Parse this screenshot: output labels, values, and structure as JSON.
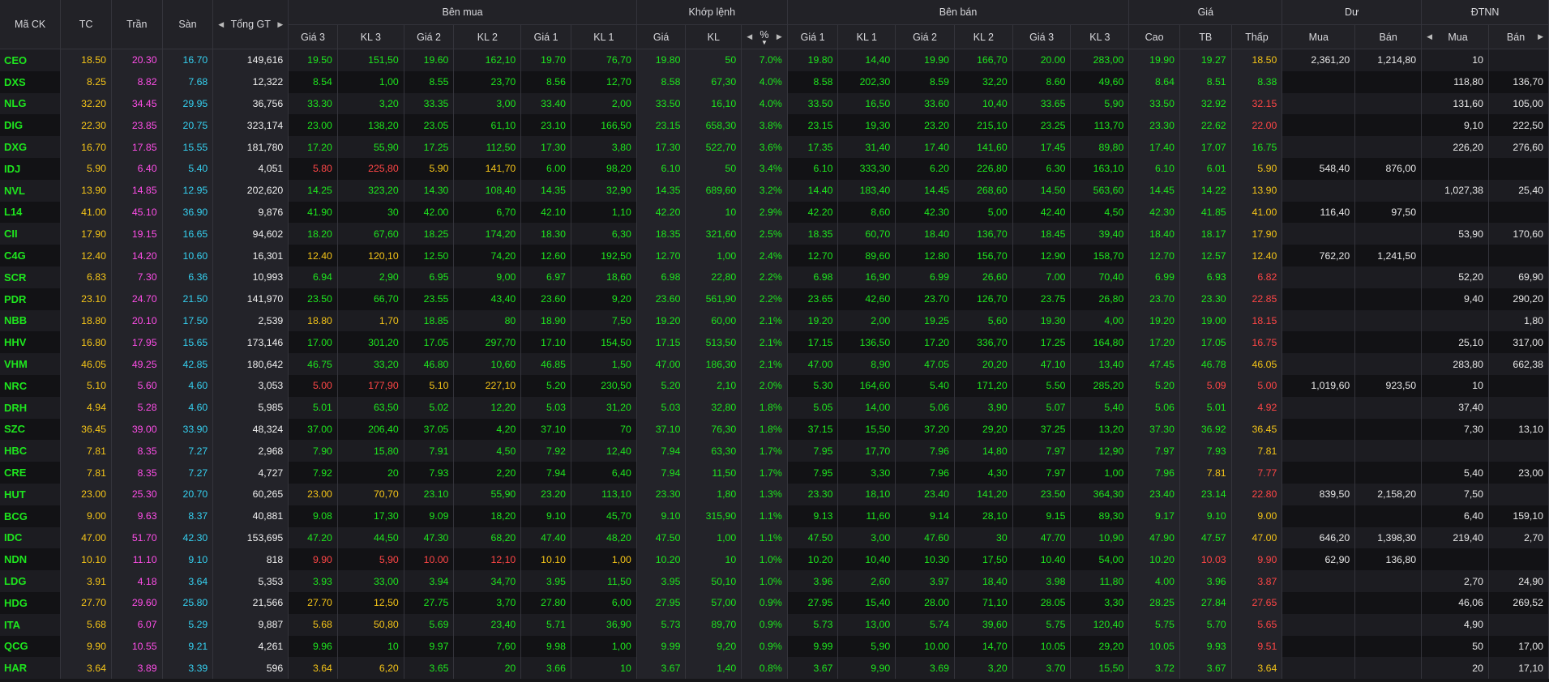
{
  "headers": {
    "symbol": "Mã CK",
    "ref": "TC",
    "ceil": "Trần",
    "floor": "Sàn",
    "total": "Tổng GT",
    "buy_group": "Bên mua",
    "match_group": "Khớp lệnh",
    "sell_group": "Bên bán",
    "price_group": "Giá",
    "surplus_group": "Dư",
    "foreign_group": "ĐTNN",
    "buy_cols": [
      "Giá 3",
      "KL 3",
      "Giá 2",
      "KL 2",
      "Giá 1",
      "KL 1"
    ],
    "match_cols": [
      "Giá",
      "KL",
      "%"
    ],
    "sell_cols": [
      "Giá 1",
      "KL 1",
      "Giá 2",
      "KL 2",
      "Giá 3",
      "KL 3"
    ],
    "price_cols": [
      "Cao",
      "TB",
      "Thấp"
    ],
    "surplus_cols": [
      "Mua",
      "Bán"
    ],
    "foreign_cols": [
      "Mua",
      "Bán"
    ]
  },
  "colors": {
    "up": "#1ee61e",
    "down": "#ff4646",
    "ref": "#f5c518",
    "ceil": "#ff4ee8",
    "floor": "#35d0f0"
  },
  "rows": [
    {
      "s": "CEO",
      "tc": "18.50",
      "tran": "20.30",
      "san": "16.70",
      "gt": "149,616",
      "b3": "19.50",
      "bk3": "151,50",
      "b2": "19.60",
      "bk2": "162,10",
      "b1": "19.70",
      "bk1": "76,70",
      "m": "19.80",
      "mk": "50",
      "pct": "7.0%",
      "s1": "19.80",
      "sk1": "14,40",
      "s2": "19.90",
      "sk2": "166,70",
      "s3": "20.00",
      "sk3": "283,00",
      "cao": "19.90",
      "tb": "19.27",
      "thap": "18.50",
      "dm": "2,361,20",
      "db": "1,214,80",
      "fm": "10",
      "fb": ""
    },
    {
      "s": "DXS",
      "tc": "8.25",
      "tran": "8.82",
      "san": "7.68",
      "gt": "12,322",
      "b3": "8.54",
      "bk3": "1,00",
      "b2": "8.55",
      "bk2": "23,70",
      "b1": "8.56",
      "bk1": "12,70",
      "m": "8.58",
      "mk": "67,30",
      "pct": "4.0%",
      "s1": "8.58",
      "sk1": "202,30",
      "s2": "8.59",
      "sk2": "32,20",
      "s3": "8.60",
      "sk3": "49,60",
      "cao": "8.64",
      "tb": "8.51",
      "thap": "8.38",
      "dm": "",
      "db": "",
      "fm": "118,80",
      "fb": "136,70"
    },
    {
      "s": "NLG",
      "tc": "32.20",
      "tran": "34.45",
      "san": "29.95",
      "gt": "36,756",
      "b3": "33.30",
      "bk3": "3,20",
      "b2": "33.35",
      "bk2": "3,00",
      "b1": "33.40",
      "bk1": "2,00",
      "m": "33.50",
      "mk": "16,10",
      "pct": "4.0%",
      "s1": "33.50",
      "sk1": "16,50",
      "s2": "33.60",
      "sk2": "10,40",
      "s3": "33.65",
      "sk3": "5,90",
      "cao": "33.50",
      "tb": "32.92",
      "thap": "32.15",
      "dm": "",
      "db": "",
      "fm": "131,60",
      "fb": "105,00"
    },
    {
      "s": "DIG",
      "tc": "22.30",
      "tran": "23.85",
      "san": "20.75",
      "gt": "323,174",
      "b3": "23.00",
      "bk3": "138,20",
      "b2": "23.05",
      "bk2": "61,10",
      "b1": "23.10",
      "bk1": "166,50",
      "m": "23.15",
      "mk": "658,30",
      "pct": "3.8%",
      "s1": "23.15",
      "sk1": "19,30",
      "s2": "23.20",
      "sk2": "215,10",
      "s3": "23.25",
      "sk3": "113,70",
      "cao": "23.30",
      "tb": "22.62",
      "thap": "22.00",
      "dm": "",
      "db": "",
      "fm": "9,10",
      "fb": "222,50"
    },
    {
      "s": "DXG",
      "tc": "16.70",
      "tran": "17.85",
      "san": "15.55",
      "gt": "181,780",
      "b3": "17.20",
      "bk3": "55,90",
      "b2": "17.25",
      "bk2": "112,50",
      "b1": "17.30",
      "bk1": "3,80",
      "m": "17.30",
      "mk": "522,70",
      "pct": "3.6%",
      "s1": "17.35",
      "sk1": "31,40",
      "s2": "17.40",
      "sk2": "141,60",
      "s3": "17.45",
      "sk3": "89,80",
      "cao": "17.40",
      "tb": "17.07",
      "thap": "16.75",
      "dm": "",
      "db": "",
      "fm": "226,20",
      "fb": "276,60"
    },
    {
      "s": "IDJ",
      "tc": "5.90",
      "tran": "6.40",
      "san": "5.40",
      "gt": "4,051",
      "b3": "5.80",
      "bk3": "225,80",
      "b2": "5.90",
      "bk2": "141,70",
      "b1": "6.00",
      "bk1": "98,20",
      "m": "6.10",
      "mk": "50",
      "pct": "3.4%",
      "s1": "6.10",
      "sk1": "333,30",
      "s2": "6.20",
      "sk2": "226,80",
      "s3": "6.30",
      "sk3": "163,10",
      "cao": "6.10",
      "tb": "6.01",
      "thap": "5.90",
      "dm": "548,40",
      "db": "876,00",
      "fm": "",
      "fb": ""
    },
    {
      "s": "NVL",
      "tc": "13.90",
      "tran": "14.85",
      "san": "12.95",
      "gt": "202,620",
      "b3": "14.25",
      "bk3": "323,20",
      "b2": "14.30",
      "bk2": "108,40",
      "b1": "14.35",
      "bk1": "32,90",
      "m": "14.35",
      "mk": "689,60",
      "pct": "3.2%",
      "s1": "14.40",
      "sk1": "183,40",
      "s2": "14.45",
      "sk2": "268,60",
      "s3": "14.50",
      "sk3": "563,60",
      "cao": "14.45",
      "tb": "14.22",
      "thap": "13.90",
      "dm": "",
      "db": "",
      "fm": "1,027,38",
      "fb": "25,40"
    },
    {
      "s": "L14",
      "tc": "41.00",
      "tran": "45.10",
      "san": "36.90",
      "gt": "9,876",
      "b3": "41.90",
      "bk3": "30",
      "b2": "42.00",
      "bk2": "6,70",
      "b1": "42.10",
      "bk1": "1,10",
      "m": "42.20",
      "mk": "10",
      "pct": "2.9%",
      "s1": "42.20",
      "sk1": "8,60",
      "s2": "42.30",
      "sk2": "5,00",
      "s3": "42.40",
      "sk3": "4,50",
      "cao": "42.30",
      "tb": "41.85",
      "thap": "41.00",
      "dm": "116,40",
      "db": "97,50",
      "fm": "",
      "fb": ""
    },
    {
      "s": "CII",
      "tc": "17.90",
      "tran": "19.15",
      "san": "16.65",
      "gt": "94,602",
      "b3": "18.20",
      "bk3": "67,60",
      "b2": "18.25",
      "bk2": "174,20",
      "b1": "18.30",
      "bk1": "6,30",
      "m": "18.35",
      "mk": "321,60",
      "pct": "2.5%",
      "s1": "18.35",
      "sk1": "60,70",
      "s2": "18.40",
      "sk2": "136,70",
      "s3": "18.45",
      "sk3": "39,40",
      "cao": "18.40",
      "tb": "18.17",
      "thap": "17.90",
      "dm": "",
      "db": "",
      "fm": "53,90",
      "fb": "170,60"
    },
    {
      "s": "C4G",
      "tc": "12.40",
      "tran": "14.20",
      "san": "10.60",
      "gt": "16,301",
      "b3": "12.40",
      "bk3": "120,10",
      "b2": "12.50",
      "bk2": "74,20",
      "b1": "12.60",
      "bk1": "192,50",
      "m": "12.70",
      "mk": "1,00",
      "pct": "2.4%",
      "s1": "12.70",
      "sk1": "89,60",
      "s2": "12.80",
      "sk2": "156,70",
      "s3": "12.90",
      "sk3": "158,70",
      "cao": "12.70",
      "tb": "12.57",
      "thap": "12.40",
      "dm": "762,20",
      "db": "1,241,50",
      "fm": "",
      "fb": ""
    },
    {
      "s": "SCR",
      "tc": "6.83",
      "tran": "7.30",
      "san": "6.36",
      "gt": "10,993",
      "b3": "6.94",
      "bk3": "2,90",
      "b2": "6.95",
      "bk2": "9,00",
      "b1": "6.97",
      "bk1": "18,60",
      "m": "6.98",
      "mk": "22,80",
      "pct": "2.2%",
      "s1": "6.98",
      "sk1": "16,90",
      "s2": "6.99",
      "sk2": "26,60",
      "s3": "7.00",
      "sk3": "70,40",
      "cao": "6.99",
      "tb": "6.93",
      "thap": "6.82",
      "dm": "",
      "db": "",
      "fm": "52,20",
      "fb": "69,90"
    },
    {
      "s": "PDR",
      "tc": "23.10",
      "tran": "24.70",
      "san": "21.50",
      "gt": "141,970",
      "b3": "23.50",
      "bk3": "66,70",
      "b2": "23.55",
      "bk2": "43,40",
      "b1": "23.60",
      "bk1": "9,20",
      "m": "23.60",
      "mk": "561,90",
      "pct": "2.2%",
      "s1": "23.65",
      "sk1": "42,60",
      "s2": "23.70",
      "sk2": "126,70",
      "s3": "23.75",
      "sk3": "26,80",
      "cao": "23.70",
      "tb": "23.30",
      "thap": "22.85",
      "dm": "",
      "db": "",
      "fm": "9,40",
      "fb": "290,20"
    },
    {
      "s": "NBB",
      "tc": "18.80",
      "tran": "20.10",
      "san": "17.50",
      "gt": "2,539",
      "b3": "18.80",
      "bk3": "1,70",
      "b2": "18.85",
      "bk2": "80",
      "b1": "18.90",
      "bk1": "7,50",
      "m": "19.20",
      "mk": "60,00",
      "pct": "2.1%",
      "s1": "19.20",
      "sk1": "2,00",
      "s2": "19.25",
      "sk2": "5,60",
      "s3": "19.30",
      "sk3": "4,00",
      "cao": "19.20",
      "tb": "19.00",
      "thap": "18.15",
      "dm": "",
      "db": "",
      "fm": "",
      "fb": "1,80"
    },
    {
      "s": "HHV",
      "tc": "16.80",
      "tran": "17.95",
      "san": "15.65",
      "gt": "173,146",
      "b3": "17.00",
      "bk3": "301,20",
      "b2": "17.05",
      "bk2": "297,70",
      "b1": "17.10",
      "bk1": "154,50",
      "m": "17.15",
      "mk": "513,50",
      "pct": "2.1%",
      "s1": "17.15",
      "sk1": "136,50",
      "s2": "17.20",
      "sk2": "336,70",
      "s3": "17.25",
      "sk3": "164,80",
      "cao": "17.20",
      "tb": "17.05",
      "thap": "16.75",
      "dm": "",
      "db": "",
      "fm": "25,10",
      "fb": "317,00"
    },
    {
      "s": "VHM",
      "tc": "46.05",
      "tran": "49.25",
      "san": "42.85",
      "gt": "180,642",
      "b3": "46.75",
      "bk3": "33,20",
      "b2": "46.80",
      "bk2": "10,60",
      "b1": "46.85",
      "bk1": "1,50",
      "m": "47.00",
      "mk": "186,30",
      "pct": "2.1%",
      "s1": "47.00",
      "sk1": "8,90",
      "s2": "47.05",
      "sk2": "20,20",
      "s3": "47.10",
      "sk3": "13,40",
      "cao": "47.45",
      "tb": "46.78",
      "thap": "46.05",
      "dm": "",
      "db": "",
      "fm": "283,80",
      "fb": "662,38"
    },
    {
      "s": "NRC",
      "tc": "5.10",
      "tran": "5.60",
      "san": "4.60",
      "gt": "3,053",
      "b3": "5.00",
      "bk3": "177,90",
      "b2": "5.10",
      "bk2": "227,10",
      "b1": "5.20",
      "bk1": "230,50",
      "m": "5.20",
      "mk": "2,10",
      "pct": "2.0%",
      "s1": "5.30",
      "sk1": "164,60",
      "s2": "5.40",
      "sk2": "171,20",
      "s3": "5.50",
      "sk3": "285,20",
      "cao": "5.20",
      "tb": "5.09",
      "thap": "5.00",
      "dm": "1,019,60",
      "db": "923,50",
      "fm": "10",
      "fb": ""
    },
    {
      "s": "DRH",
      "tc": "4.94",
      "tran": "5.28",
      "san": "4.60",
      "gt": "5,985",
      "b3": "5.01",
      "bk3": "63,50",
      "b2": "5.02",
      "bk2": "12,20",
      "b1": "5.03",
      "bk1": "31,20",
      "m": "5.03",
      "mk": "32,80",
      "pct": "1.8%",
      "s1": "5.05",
      "sk1": "14,00",
      "s2": "5.06",
      "sk2": "3,90",
      "s3": "5.07",
      "sk3": "5,40",
      "cao": "5.06",
      "tb": "5.01",
      "thap": "4.92",
      "dm": "",
      "db": "",
      "fm": "37,40",
      "fb": ""
    },
    {
      "s": "SZC",
      "tc": "36.45",
      "tran": "39.00",
      "san": "33.90",
      "gt": "48,324",
      "b3": "37.00",
      "bk3": "206,40",
      "b2": "37.05",
      "bk2": "4,20",
      "b1": "37.10",
      "bk1": "70",
      "m": "37.10",
      "mk": "76,30",
      "pct": "1.8%",
      "s1": "37.15",
      "sk1": "15,50",
      "s2": "37.20",
      "sk2": "29,20",
      "s3": "37.25",
      "sk3": "13,20",
      "cao": "37.30",
      "tb": "36.92",
      "thap": "36.45",
      "dm": "",
      "db": "",
      "fm": "7,30",
      "fb": "13,10"
    },
    {
      "s": "HBC",
      "tc": "7.81",
      "tran": "8.35",
      "san": "7.27",
      "gt": "2,968",
      "b3": "7.90",
      "bk3": "15,80",
      "b2": "7.91",
      "bk2": "4,50",
      "b1": "7.92",
      "bk1": "12,40",
      "m": "7.94",
      "mk": "63,30",
      "pct": "1.7%",
      "s1": "7.95",
      "sk1": "17,70",
      "s2": "7.96",
      "sk2": "14,80",
      "s3": "7.97",
      "sk3": "12,90",
      "cao": "7.97",
      "tb": "7.93",
      "thap": "7.81",
      "dm": "",
      "db": "",
      "fm": "",
      "fb": ""
    },
    {
      "s": "CRE",
      "tc": "7.81",
      "tran": "8.35",
      "san": "7.27",
      "gt": "4,727",
      "b3": "7.92",
      "bk3": "20",
      "b2": "7.93",
      "bk2": "2,20",
      "b1": "7.94",
      "bk1": "6,40",
      "m": "7.94",
      "mk": "11,50",
      "pct": "1.7%",
      "s1": "7.95",
      "sk1": "3,30",
      "s2": "7.96",
      "sk2": "4,30",
      "s3": "7.97",
      "sk3": "1,00",
      "cao": "7.96",
      "tb": "7.81",
      "thap": "7.77",
      "dm": "",
      "db": "",
      "fm": "5,40",
      "fb": "23,00"
    },
    {
      "s": "HUT",
      "tc": "23.00",
      "tran": "25.30",
      "san": "20.70",
      "gt": "60,265",
      "b3": "23.00",
      "bk3": "70,70",
      "b2": "23.10",
      "bk2": "55,90",
      "b1": "23.20",
      "bk1": "113,10",
      "m": "23.30",
      "mk": "1,80",
      "pct": "1.3%",
      "s1": "23.30",
      "sk1": "18,10",
      "s2": "23.40",
      "sk2": "141,20",
      "s3": "23.50",
      "sk3": "364,30",
      "cao": "23.40",
      "tb": "23.14",
      "thap": "22.80",
      "dm": "839,50",
      "db": "2,158,20",
      "fm": "7,50",
      "fb": ""
    },
    {
      "s": "BCG",
      "tc": "9.00",
      "tran": "9.63",
      "san": "8.37",
      "gt": "40,881",
      "b3": "9.08",
      "bk3": "17,30",
      "b2": "9.09",
      "bk2": "18,20",
      "b1": "9.10",
      "bk1": "45,70",
      "m": "9.10",
      "mk": "315,90",
      "pct": "1.1%",
      "s1": "9.13",
      "sk1": "11,60",
      "s2": "9.14",
      "sk2": "28,10",
      "s3": "9.15",
      "sk3": "89,30",
      "cao": "9.17",
      "tb": "9.10",
      "thap": "9.00",
      "dm": "",
      "db": "",
      "fm": "6,40",
      "fb": "159,10"
    },
    {
      "s": "IDC",
      "tc": "47.00",
      "tran": "51.70",
      "san": "42.30",
      "gt": "153,695",
      "b3": "47.20",
      "bk3": "44,50",
      "b2": "47.30",
      "bk2": "68,20",
      "b1": "47.40",
      "bk1": "48,20",
      "m": "47.50",
      "mk": "1,00",
      "pct": "1.1%",
      "s1": "47.50",
      "sk1": "3,00",
      "s2": "47.60",
      "sk2": "30",
      "s3": "47.70",
      "sk3": "10,90",
      "cao": "47.90",
      "tb": "47.57",
      "thap": "47.00",
      "dm": "646,20",
      "db": "1,398,30",
      "fm": "219,40",
      "fb": "2,70"
    },
    {
      "s": "NDN",
      "tc": "10.10",
      "tran": "11.10",
      "san": "9.10",
      "gt": "818",
      "b3": "9.90",
      "bk3": "5,90",
      "b2": "10.00",
      "bk2": "12,10",
      "b1": "10.10",
      "bk1": "1,00",
      "m": "10.20",
      "mk": "10",
      "pct": "1.0%",
      "s1": "10.20",
      "sk1": "10,40",
      "s2": "10.30",
      "sk2": "17,50",
      "s3": "10.40",
      "sk3": "54,00",
      "cao": "10.20",
      "tb": "10.03",
      "thap": "9.90",
      "dm": "62,90",
      "db": "136,80",
      "fm": "",
      "fb": ""
    },
    {
      "s": "LDG",
      "tc": "3.91",
      "tran": "4.18",
      "san": "3.64",
      "gt": "5,353",
      "b3": "3.93",
      "bk3": "33,00",
      "b2": "3.94",
      "bk2": "34,70",
      "b1": "3.95",
      "bk1": "11,50",
      "m": "3.95",
      "mk": "50,10",
      "pct": "1.0%",
      "s1": "3.96",
      "sk1": "2,60",
      "s2": "3.97",
      "sk2": "18,40",
      "s3": "3.98",
      "sk3": "11,80",
      "cao": "4.00",
      "tb": "3.96",
      "thap": "3.87",
      "dm": "",
      "db": "",
      "fm": "2,70",
      "fb": "24,90"
    },
    {
      "s": "HDG",
      "tc": "27.70",
      "tran": "29.60",
      "san": "25.80",
      "gt": "21,566",
      "b3": "27.70",
      "bk3": "12,50",
      "b2": "27.75",
      "bk2": "3,70",
      "b1": "27.80",
      "bk1": "6,00",
      "m": "27.95",
      "mk": "57,00",
      "pct": "0.9%",
      "s1": "27.95",
      "sk1": "15,40",
      "s2": "28.00",
      "sk2": "71,10",
      "s3": "28.05",
      "sk3": "3,30",
      "cao": "28.25",
      "tb": "27.84",
      "thap": "27.65",
      "dm": "",
      "db": "",
      "fm": "46,06",
      "fb": "269,52"
    },
    {
      "s": "ITA",
      "tc": "5.68",
      "tran": "6.07",
      "san": "5.29",
      "gt": "9,887",
      "b3": "5.68",
      "bk3": "50,80",
      "b2": "5.69",
      "bk2": "23,40",
      "b1": "5.71",
      "bk1": "36,90",
      "m": "5.73",
      "mk": "89,70",
      "pct": "0.9%",
      "s1": "5.73",
      "sk1": "13,00",
      "s2": "5.74",
      "sk2": "39,60",
      "s3": "5.75",
      "sk3": "120,40",
      "cao": "5.75",
      "tb": "5.70",
      "thap": "5.65",
      "dm": "",
      "db": "",
      "fm": "4,90",
      "fb": ""
    },
    {
      "s": "QCG",
      "tc": "9.90",
      "tran": "10.55",
      "san": "9.21",
      "gt": "4,261",
      "b3": "9.96",
      "bk3": "10",
      "b2": "9.97",
      "bk2": "7,60",
      "b1": "9.98",
      "bk1": "1,00",
      "m": "9.99",
      "mk": "9,20",
      "pct": "0.9%",
      "s1": "9.99",
      "sk1": "5,90",
      "s2": "10.00",
      "sk2": "14,70",
      "s3": "10.05",
      "sk3": "29,20",
      "cao": "10.05",
      "tb": "9.93",
      "thap": "9.51",
      "dm": "",
      "db": "",
      "fm": "50",
      "fb": "17,00"
    },
    {
      "s": "HAR",
      "tc": "3.64",
      "tran": "3.89",
      "san": "3.39",
      "gt": "596",
      "b3": "3.64",
      "bk3": "6,20",
      "b2": "3.65",
      "bk2": "20",
      "b1": "3.66",
      "bk1": "10",
      "m": "3.67",
      "mk": "1,40",
      "pct": "0.8%",
      "s1": "3.67",
      "sk1": "9,90",
      "s2": "3.69",
      "sk2": "3,20",
      "s3": "3.70",
      "sk3": "15,50",
      "cao": "3.72",
      "tb": "3.67",
      "thap": "3.64",
      "dm": "",
      "db": "",
      "fm": "20",
      "fb": "17,10"
    }
  ]
}
